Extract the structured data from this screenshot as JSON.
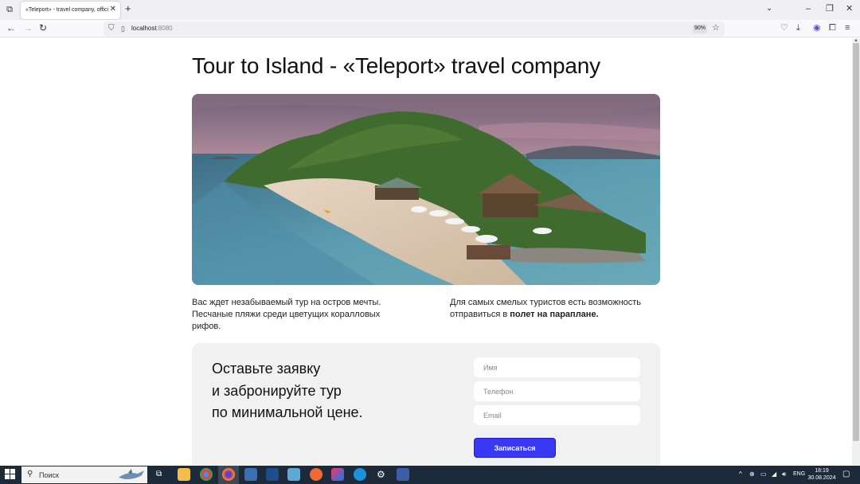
{
  "browser": {
    "tab_title": "«Teleport» - travel company, official site",
    "url_host": "localhost",
    "url_port": ":8080",
    "zoom": "90%"
  },
  "page": {
    "title": "Tour to Island - «Teleport» travel company",
    "description_left": "Вас ждет незабываемый тур на остров мечты. Песчаные пляжи среди цветущих коралловых рифов.",
    "description_right_text": "Для самых смелых туристов есть возможность отправиться в ",
    "description_right_bold": "полет на параплане."
  },
  "form": {
    "heading_line1": "Оставьте заявку",
    "heading_line2": "и забронируйте тур",
    "heading_line3": "по минимальной цене.",
    "name_placeholder": "Имя",
    "phone_placeholder": "Телефон",
    "email_placeholder": "Email",
    "submit_label": "Записаться"
  },
  "taskbar": {
    "search_placeholder": "Поиск",
    "language": "ENG",
    "time": "18:19",
    "date": "30.08.2024"
  },
  "colors": {
    "accent": "#3838f5",
    "card_bg": "#f1f1f1",
    "taskbar_bg": "#1c2a3a"
  }
}
